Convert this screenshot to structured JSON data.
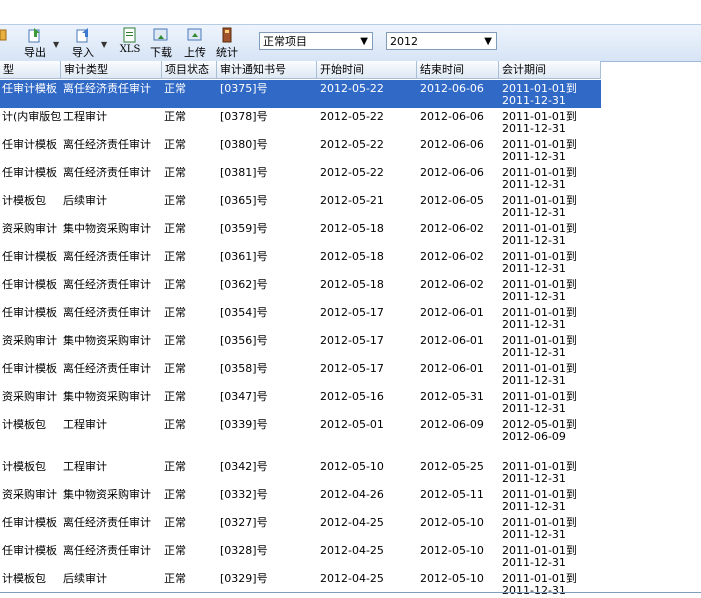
{
  "toolbar": {
    "buttons": [
      {
        "label": "",
        "icon": "generic-icon"
      },
      {
        "label": "导出",
        "icon": "export-icon"
      },
      {
        "label": "导入",
        "icon": "import-icon"
      },
      {
        "label": "XLS",
        "icon": "xls-icon"
      },
      {
        "label": "下载",
        "icon": "download-icon"
      },
      {
        "label": "上传",
        "icon": "upload-icon"
      },
      {
        "label": "统计",
        "icon": "statistics-icon"
      }
    ],
    "project_filter": "正常项目",
    "year_filter": "2012"
  },
  "columns": [
    "型",
    "审计类型",
    "项目状态",
    "审计通知书号",
    "开始时间",
    "结束时间",
    "会计期间"
  ],
  "rows": [
    [
      "任审计模板",
      "离任经济责任审计",
      "正常",
      "[0375]号",
      "2012-05-22",
      "2012-06-06",
      "2011-01-01到",
      "2011-12-31"
    ],
    [
      "计(内审版包",
      "工程审计",
      "正常",
      "[0378]号",
      "2012-05-22",
      "2012-06-06",
      "2011-01-01到",
      "2011-12-31"
    ],
    [
      "任审计模板",
      "离任经济责任审计",
      "正常",
      "[0380]号",
      "2012-05-22",
      "2012-06-06",
      "2011-01-01到",
      "2011-12-31"
    ],
    [
      "任审计模板",
      "离任经济责任审计",
      "正常",
      "[0381]号",
      "2012-05-22",
      "2012-06-06",
      "2011-01-01到",
      "2011-12-31"
    ],
    [
      "计模板包",
      "后续审计",
      "正常",
      "[0365]号",
      "2012-05-21",
      "2012-06-05",
      "2011-01-01到",
      "2011-12-31"
    ],
    [
      "资采购审计",
      "集中物资采购审计",
      "正常",
      "[0359]号",
      "2012-05-18",
      "2012-06-02",
      "2011-01-01到",
      "2011-12-31"
    ],
    [
      "任审计模板",
      "离任经济责任审计",
      "正常",
      "[0361]号",
      "2012-05-18",
      "2012-06-02",
      "2011-01-01到",
      "2011-12-31"
    ],
    [
      "任审计模板",
      "离任经济责任审计",
      "正常",
      "[0362]号",
      "2012-05-18",
      "2012-06-02",
      "2011-01-01到",
      "2011-12-31"
    ],
    [
      "任审计模板",
      "离任经济责任审计",
      "正常",
      "[0354]号",
      "2012-05-17",
      "2012-06-01",
      "2011-01-01到",
      "2011-12-31"
    ],
    [
      "资采购审计",
      "集中物资采购审计",
      "正常",
      "[0356]号",
      "2012-05-17",
      "2012-06-01",
      "2011-01-01到",
      "2011-12-31"
    ],
    [
      "任审计模板",
      "离任经济责任审计",
      "正常",
      "[0358]号",
      "2012-05-17",
      "2012-06-01",
      "2011-01-01到",
      "2011-12-31"
    ],
    [
      "资采购审计",
      "集中物资采购审计",
      "正常",
      "[0347]号",
      "2012-05-16",
      "2012-05-31",
      "2011-01-01到",
      "2011-12-31"
    ],
    [
      "计模板包",
      "工程审计",
      "正常",
      "[0339]号",
      "2012-05-01",
      "2012-06-09",
      "2012-05-01到",
      "2012-06-09"
    ],
    [
      "计模板包",
      "工程审计",
      "正常",
      "[0342]号",
      "2012-05-10",
      "2012-05-25",
      "2011-01-01到",
      "2011-12-31"
    ],
    [
      "资采购审计",
      "集中物资采购审计",
      "正常",
      "[0332]号",
      "2012-04-26",
      "2012-05-11",
      "2011-01-01到",
      "2011-12-31"
    ],
    [
      "任审计模板",
      "离任经济责任审计",
      "正常",
      "[0327]号",
      "2012-04-25",
      "2012-05-10",
      "2011-01-01到",
      "2011-12-31"
    ],
    [
      "任审计模板",
      "离任经济责任审计",
      "正常",
      "[0328]号",
      "2012-04-25",
      "2012-05-10",
      "2011-01-01到",
      "2011-12-31"
    ],
    [
      "计模板包",
      "后续审计",
      "正常",
      "[0329]号",
      "2012-04-25",
      "2012-05-10",
      "2011-01-01到",
      "2011-12-31"
    ]
  ]
}
